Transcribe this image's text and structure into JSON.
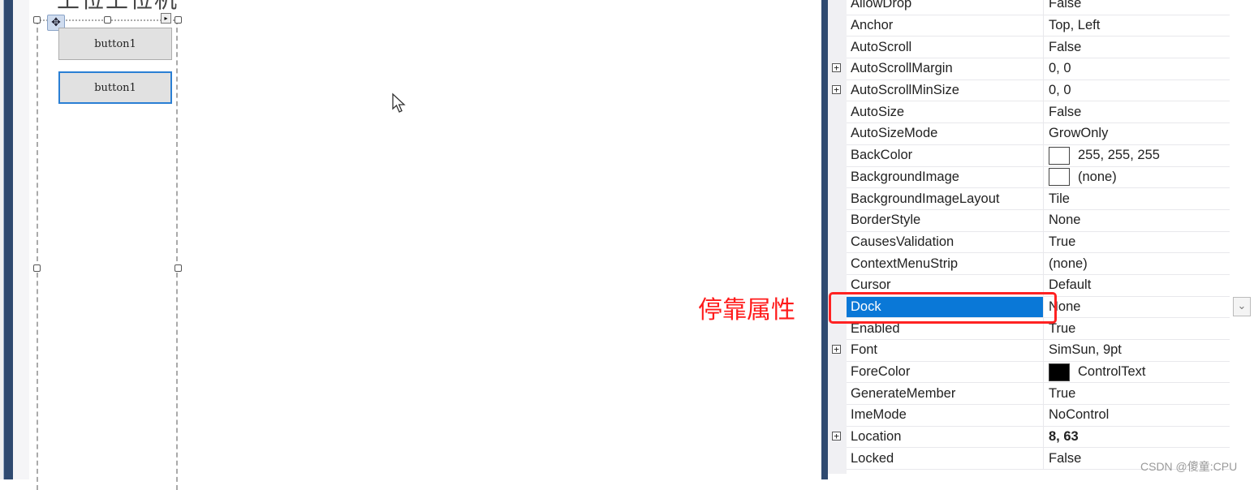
{
  "designer": {
    "form_title_partial": "上位上位机",
    "buttons": [
      {
        "label": "button1",
        "focused": false
      },
      {
        "label": "button1",
        "focused": true
      }
    ]
  },
  "annotation": {
    "text": "停靠属性",
    "color": "#ff1a1a"
  },
  "property_grid": {
    "selected_property": "Dock",
    "rows": [
      {
        "name": "AllowDrop",
        "value": "False"
      },
      {
        "name": "Anchor",
        "value": "Top, Left"
      },
      {
        "name": "AutoScroll",
        "value": "False"
      },
      {
        "name": "AutoScrollMargin",
        "value": "0, 0",
        "expandable": true
      },
      {
        "name": "AutoScrollMinSize",
        "value": "0, 0",
        "expandable": true
      },
      {
        "name": "AutoSize",
        "value": "False"
      },
      {
        "name": "AutoSizeMode",
        "value": "GrowOnly"
      },
      {
        "name": "BackColor",
        "value": "255, 255, 255",
        "swatch": "#ffffff"
      },
      {
        "name": "BackgroundImage",
        "value": "(none)",
        "swatch": "#ffffff"
      },
      {
        "name": "BackgroundImageLayout",
        "value": "Tile"
      },
      {
        "name": "BorderStyle",
        "value": "None"
      },
      {
        "name": "CausesValidation",
        "value": "True"
      },
      {
        "name": "ContextMenuStrip",
        "value": "(none)"
      },
      {
        "name": "Cursor",
        "value": "Default"
      },
      {
        "name": "Dock",
        "value": "None",
        "selected": true,
        "dropdown": true
      },
      {
        "name": "Enabled",
        "value": "True"
      },
      {
        "name": "Font",
        "value": "SimSun, 9pt",
        "expandable": true
      },
      {
        "name": "ForeColor",
        "value": "ControlText",
        "swatch": "#000000"
      },
      {
        "name": "GenerateMember",
        "value": "True"
      },
      {
        "name": "ImeMode",
        "value": "NoControl"
      },
      {
        "name": "Location",
        "value": "8, 63",
        "expandable": true,
        "bold": true
      },
      {
        "name": "Locked",
        "value": "False"
      }
    ]
  },
  "watermark": "CSDN @傻童:CPU",
  "icons": {
    "expand": "⊞",
    "move": "✥",
    "smart_tag": "▸",
    "dropdown": "⌄"
  }
}
